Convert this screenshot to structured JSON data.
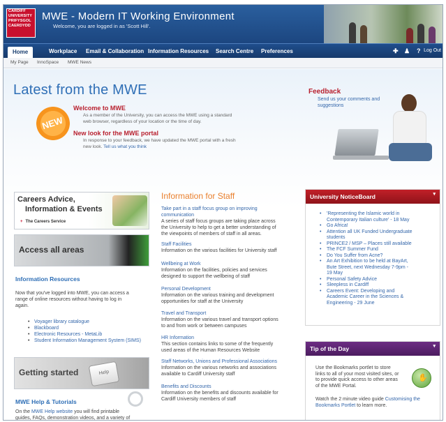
{
  "brand": {
    "logo_lines": [
      "CARDIFF",
      "UNIVERSITY",
      "PRIFYSGOL",
      "CAERDYDD"
    ],
    "title": "MWE - Modern IT Working Environment",
    "welcome": "Welcome, you are logged in as 'Scott Hill'."
  },
  "nav": {
    "tabs": [
      "Home",
      "Workplace",
      "Email & Collaboration",
      "Information Resources",
      "Search Centre",
      "Preferences"
    ],
    "active_tab": "Home",
    "icons": [
      "add-icon",
      "user-icon",
      "help-icon"
    ],
    "logout": "Log Out"
  },
  "subnav": [
    "My Page",
    "InnoSpace",
    "MWE News"
  ],
  "latest": {
    "title": "Latest from the MWE",
    "badge": "NEW",
    "news": [
      {
        "heading": "Welcome to MWE",
        "text": [
          "As a member of the University, you can access the MWE using a standard",
          "web browser, regardless of your location or the time of day."
        ]
      },
      {
        "heading": "New look for the MWE portal",
        "text": [
          "In response to your feedback, we have updated the MWE portal with a fresh"
        ],
        "last_line": "new look.",
        "link": "Tell us what you think"
      }
    ]
  },
  "feedback": {
    "title": "Feedback",
    "text": "Send us your comments and suggestions"
  },
  "promos": {
    "careers_line1": "Careers Advice,",
    "careers_line2": "Information & Events",
    "careers_service": "The Careers Service",
    "access": "Access all areas",
    "getting_started": "Getting started",
    "help_key": "Help"
  },
  "info_resources": {
    "heading": "Information Resources",
    "intro": [
      "Now that you've logged into MWE, you can access a",
      "range of online resources without having to log in",
      "again."
    ],
    "items": [
      "Voyager library catalogue",
      "Blackboard",
      "Electronic Resources - MetaLib",
      "Student Information Management System (SIMS)"
    ]
  },
  "help": {
    "heading": "MWE Help & Tutorials",
    "text_before": "On the",
    "link": "MWE Help website",
    "text_after": "you will find printable",
    "line2": "guides, FAQs, demonstration videos, and a variety of"
  },
  "staff": {
    "title": "Information for Staff",
    "items": [
      {
        "link": [
          "Take part in a staff focus group on improving",
          "communication"
        ],
        "desc": [
          "A series of staff focus groups are taking place across",
          "the University to help to get a better understanding of",
          "the viewpoints of members of staff in all areas."
        ]
      },
      {
        "link": [
          "Staff Facilities"
        ],
        "desc": [
          "Information on the various facilities for University staff"
        ]
      },
      {
        "link": [
          "Wellbeing at Work"
        ],
        "desc": [
          "Information on the facilities, policies and services",
          "designed to support the wellbeing of staff"
        ]
      },
      {
        "link": [
          "Personal Development"
        ],
        "desc": [
          "Information on the various training and development",
          "opportunities for staff at the University"
        ]
      },
      {
        "link": [
          "Travel and Transport"
        ],
        "desc": [
          "Information on the various travel and transport options",
          "to and from work or between campuses"
        ]
      },
      {
        "link": [
          "HR Information"
        ],
        "desc": [
          "This section contains links to some of the frequently",
          "used areas of the Human Resources Website"
        ]
      },
      {
        "link": [
          "Staff Networks, Unions and Professional Associations"
        ],
        "desc": [
          "Information on the various networks and associations",
          "available to Cardiff University staff"
        ]
      },
      {
        "link": [
          "Benefits and Discounts"
        ],
        "desc": [
          "Information on the benefits and discounts available for",
          "Cardiff University members of staff"
        ]
      }
    ]
  },
  "noticeboard": {
    "title": "University NoticeBoard",
    "items": [
      [
        "'Representing the Islamic world in",
        "Contemporary Italian culture' - 18 May"
      ],
      [
        "Go Africa!"
      ],
      [
        "Attention all UK Funded Undergraduate",
        "students"
      ],
      [
        "PRINCE2 / MSP – Places still available"
      ],
      [
        "The FCF Summer Fund"
      ],
      [
        "Do You Suffer from Acne?"
      ],
      [
        "An Art Exhibition to be held at BayArt,",
        "Bute Street, next Wednesday 7-9pm -",
        "19 May"
      ],
      [
        "Personal Safety Advice"
      ],
      [
        "Sleepless in Cardiff"
      ],
      [
        "Careers Event: Developing and",
        "Academic Career in the Sciences &",
        "Engineering - 29 June"
      ]
    ]
  },
  "tip": {
    "title": "Tip of the Day",
    "para1": [
      "Use the Bookmarks portlet to store",
      "links to all of your most visited sites, or",
      "to provide quick access to other areas",
      "of the MWE Portal."
    ],
    "para2_before": "Watch the 2 minute video guide",
    "para2_link": "Customising the",
    "para2_line2_link": "Bookmarks Portlet",
    "para2_after": "to learn more."
  },
  "colors": {
    "header_blue": "#1f4e8c",
    "accent_red": "#b8202e",
    "staff_orange": "#e9802d",
    "tip_purple": "#5a2470",
    "link_blue": "#3366aa"
  }
}
